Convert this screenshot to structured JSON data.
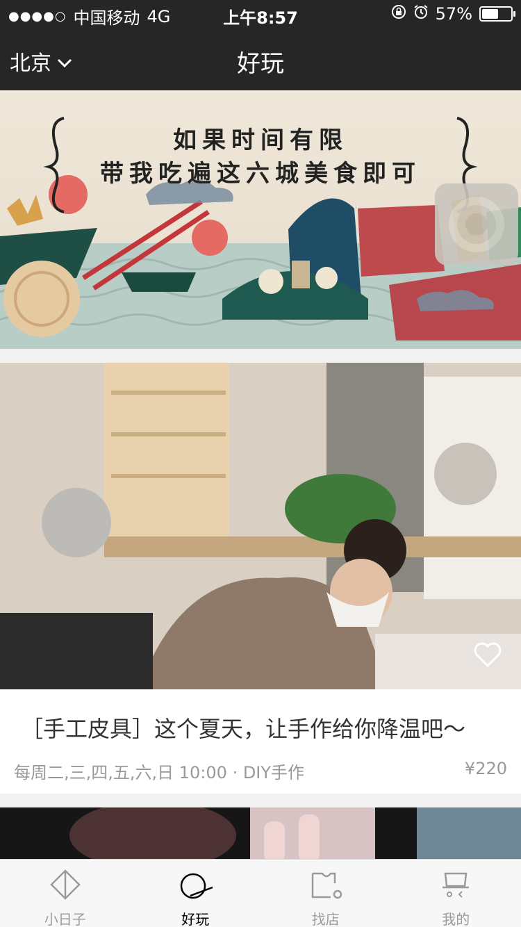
{
  "status_bar": {
    "signal": "●●●●○",
    "carrier": "中国移动",
    "network": "4G",
    "time": "上午8:57",
    "battery_percent_text": "57%",
    "battery_level": 0.57,
    "icons": [
      "orientation-lock-icon",
      "alarm-icon"
    ]
  },
  "nav": {
    "city": "北京",
    "title": "好玩"
  },
  "banner": {
    "line1": "如果时间有限",
    "line2": "带我吃遍这六城美食即可"
  },
  "card": {
    "title": "［手工皮具］这个夏天，让手作给你降温吧～",
    "meta": "每周二,三,四,五,六,日 10:00 · DIY手作",
    "price": "¥220"
  },
  "tabs": [
    {
      "label": "小日子",
      "icon": "diary-icon",
      "active": false
    },
    {
      "label": "好玩",
      "icon": "play-icon",
      "active": true
    },
    {
      "label": "找店",
      "icon": "shop-icon",
      "active": false
    },
    {
      "label": "我的",
      "icon": "profile-icon",
      "active": false
    }
  ],
  "colors": {
    "bar_bg": "#262626",
    "card_bg": "#ffffff",
    "page_bg": "#f2f2f2",
    "muted_text": "#999999"
  }
}
